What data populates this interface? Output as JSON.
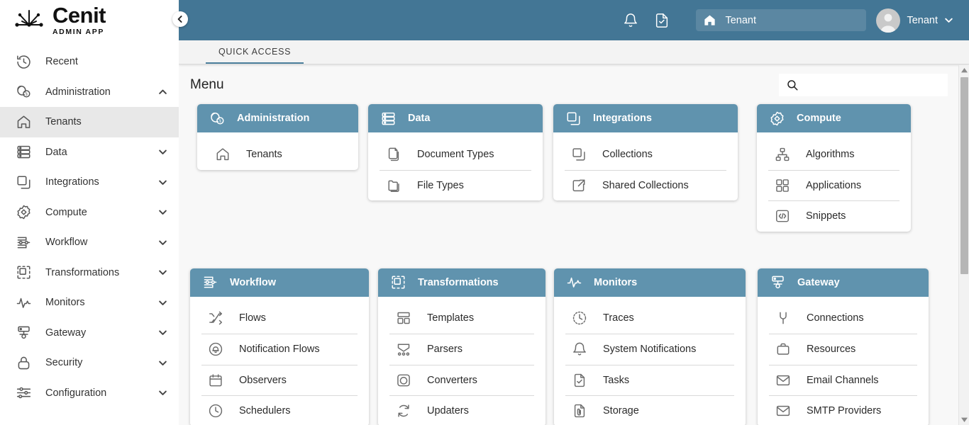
{
  "brand": {
    "name": "Cenit",
    "subtitle": "ADMIN APP",
    "logo_icon": "cenit-logo-icon"
  },
  "sidebar": {
    "collapse_icon": "chevron-left-icon",
    "items": [
      {
        "label": "Recent",
        "icon": "history-icon",
        "chevron": "",
        "active": false
      },
      {
        "label": "Administration",
        "icon": "admin-shield-icon",
        "chevron": "up",
        "active": false
      },
      {
        "label": "Tenants",
        "icon": "home-icon",
        "chevron": "",
        "active": true
      },
      {
        "label": "Data",
        "icon": "database-icon",
        "chevron": "down",
        "active": false
      },
      {
        "label": "Integrations",
        "icon": "layers-icon",
        "chevron": "down",
        "active": false
      },
      {
        "label": "Compute",
        "icon": "gear-diamond-icon",
        "chevron": "down",
        "active": false
      },
      {
        "label": "Workflow",
        "icon": "workflow-sliders-icon",
        "chevron": "down",
        "active": false
      },
      {
        "label": "Transformations",
        "icon": "dashed-square-icon",
        "chevron": "down",
        "active": false
      },
      {
        "label": "Monitors",
        "icon": "pulse-icon",
        "chevron": "down",
        "active": false
      },
      {
        "label": "Gateway",
        "icon": "gateway-node-icon",
        "chevron": "down",
        "active": false
      },
      {
        "label": "Security",
        "icon": "lock-icon",
        "chevron": "down",
        "active": false
      },
      {
        "label": "Configuration",
        "icon": "sliders-icon",
        "chevron": "down",
        "active": false
      }
    ]
  },
  "topbar": {
    "notifications_icon": "bell-icon",
    "tasks_icon": "document-check-icon",
    "tenant_field": {
      "icon": "home-icon",
      "value": "Tenant"
    },
    "user": {
      "name": "Tenant",
      "avatar_icon": "user-avatar-icon",
      "chevron_icon": "chevron-down-icon"
    },
    "accent_color": "#437695"
  },
  "tabs": [
    {
      "label": "QUICK ACCESS",
      "active": true
    }
  ],
  "main": {
    "title": "Menu",
    "search": {
      "icon": "search-icon",
      "value": "",
      "placeholder": ""
    },
    "card_header_color": "#6093ae",
    "row1": [
      {
        "title": "Administration",
        "icon": "admin-shield-icon",
        "items": [
          {
            "label": "Tenants",
            "icon": "home-icon"
          }
        ]
      },
      {
        "title": "Data",
        "icon": "database-icon",
        "items": [
          {
            "label": "Document Types",
            "icon": "document-copy-icon"
          },
          {
            "label": "File Types",
            "icon": "folder-copy-icon"
          }
        ]
      },
      {
        "title": "Integrations",
        "icon": "layers-icon",
        "items": [
          {
            "label": "Collections",
            "icon": "layers-icon"
          },
          {
            "label": "Shared Collections",
            "icon": "external-link-icon"
          }
        ]
      },
      {
        "title": "Compute",
        "icon": "gear-diamond-icon",
        "items": [
          {
            "label": "Algorithms",
            "icon": "sitemap-icon"
          },
          {
            "label": "Applications",
            "icon": "grid-squares-icon"
          },
          {
            "label": "Snippets",
            "icon": "code-brackets-icon"
          }
        ]
      }
    ],
    "row2": [
      {
        "title": "Workflow",
        "icon": "workflow-sliders-icon",
        "items": [
          {
            "label": "Flows",
            "icon": "shuffle-icon"
          },
          {
            "label": "Notification Flows",
            "icon": "bell-circle-icon"
          },
          {
            "label": "Observers",
            "icon": "calendar-icon"
          },
          {
            "label": "Schedulers",
            "icon": "clock-icon"
          }
        ]
      },
      {
        "title": "Transformations",
        "icon": "dashed-square-icon",
        "items": [
          {
            "label": "Templates",
            "icon": "layout-blocks-icon"
          },
          {
            "label": "Parsers",
            "icon": "parser-icon"
          },
          {
            "label": "Converters",
            "icon": "converter-circle-icon"
          },
          {
            "label": "Updaters",
            "icon": "refresh-icon"
          }
        ]
      },
      {
        "title": "Monitors",
        "icon": "pulse-icon",
        "items": [
          {
            "label": "Traces",
            "icon": "clock-dashed-icon"
          },
          {
            "label": "System Notifications",
            "icon": "bell-icon"
          },
          {
            "label": "Tasks",
            "icon": "document-check-icon"
          },
          {
            "label": "Storage",
            "icon": "document-clip-icon"
          }
        ]
      },
      {
        "title": "Gateway",
        "icon": "gateway-node-icon",
        "items": [
          {
            "label": "Connections",
            "icon": "plug-icon"
          },
          {
            "label": "Resources",
            "icon": "briefcase-icon"
          },
          {
            "label": "Email Channels",
            "icon": "envelope-icon"
          },
          {
            "label": "SMTP Providers",
            "icon": "envelope-icon"
          }
        ]
      }
    ]
  },
  "scrollbar": {
    "up_icon": "triangle-up-icon",
    "down_icon": "triangle-down-icon"
  }
}
